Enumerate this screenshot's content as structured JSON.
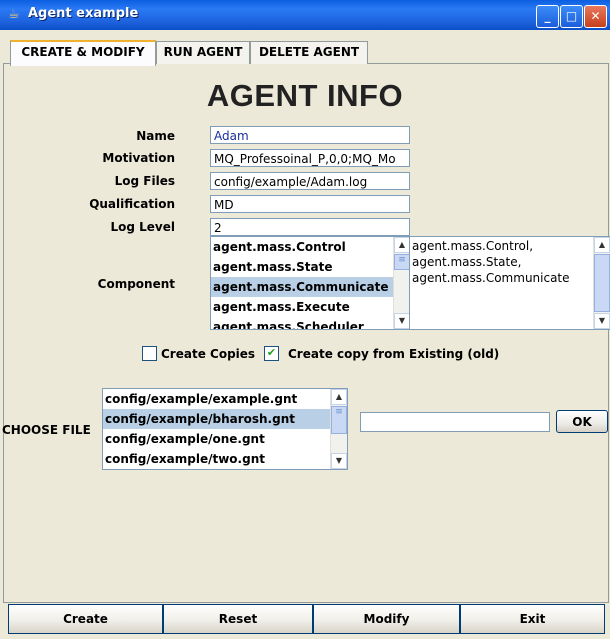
{
  "window": {
    "title": "Agent example",
    "controls": [
      "_",
      "□",
      "✕"
    ]
  },
  "tabs": [
    {
      "label": "CREATE & MODIFY",
      "active": true
    },
    {
      "label": "RUN AGENT",
      "active": false
    },
    {
      "label": "DELETE AGENT",
      "active": false
    }
  ],
  "heading": "AGENT INFO",
  "form": {
    "name": {
      "label": "Name",
      "value": "Adam"
    },
    "motivation": {
      "label": "Motivation",
      "value": "MQ_Professoinal_P,0,0;MQ_Mo"
    },
    "log_files": {
      "label": "Log Files",
      "value": "config/example/Adam.log"
    },
    "qualification": {
      "label": "Qualification",
      "value": "MD"
    },
    "log_level": {
      "label": "Log Level",
      "value": "2"
    }
  },
  "component": {
    "label": "Component",
    "items": [
      "agent.mass.Control",
      "agent.mass.State",
      "agent.mass.Communicate",
      "agent.mass.Execute",
      "agent.mass.Scheduler"
    ],
    "selected_index": 2,
    "text": "agent.mass.Control,\nagent.mass.State,\nagent.mass.Communicate"
  },
  "checkboxes": {
    "create_copies": {
      "label": "Create Copies",
      "checked": false
    },
    "create_copy_existing": {
      "label": "Create copy from Existing (old)",
      "checked": true
    }
  },
  "choose_file": {
    "label": "CHOOSE FILE",
    "files": [
      "config/example/example.gnt",
      "config/example/bharosh.gnt",
      "config/example/one.gnt",
      "config/example/two.gnt"
    ],
    "selected_index": 1,
    "path_value": "",
    "ok_label": "OK"
  },
  "actions": {
    "create": "Create",
    "reset": "Reset",
    "modify": "Modify",
    "exit": "Exit"
  }
}
